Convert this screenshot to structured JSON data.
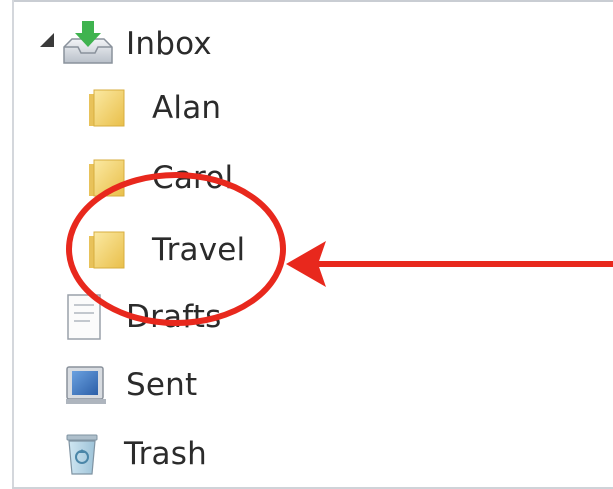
{
  "folders": {
    "inbox": {
      "label": "Inbox",
      "icon": "inbox-tray-icon",
      "expanded": true
    },
    "alan": {
      "label": "Alan",
      "icon": "folder-icon"
    },
    "carol": {
      "label": "Carol",
      "icon": "folder-icon"
    },
    "travel": {
      "label": "Travel",
      "icon": "folder-icon",
      "highlighted": true
    },
    "drafts": {
      "label": "Drafts",
      "icon": "drafts-icon"
    },
    "sent": {
      "label": "Sent",
      "icon": "sent-icon"
    },
    "trash": {
      "label": "Trash",
      "icon": "trash-icon"
    }
  },
  "annotation": {
    "shape": "circle-and-arrow",
    "target": "travel",
    "color": "#e8281d"
  },
  "colors": {
    "folder_yellow": "#f4d368",
    "inbox_arrow_green": "#3fb34f",
    "sent_blue": "#3a76c4",
    "annotation_red": "#e8281d"
  }
}
